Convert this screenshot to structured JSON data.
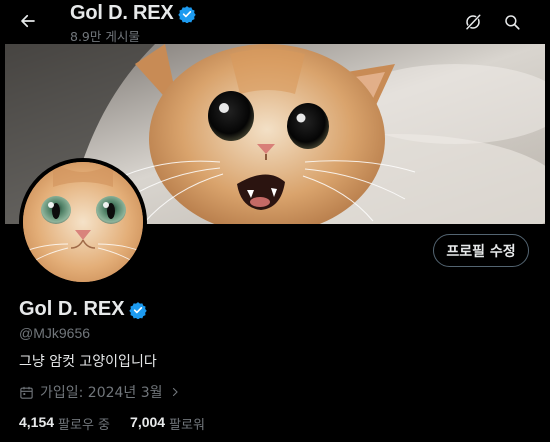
{
  "header": {
    "title": "Gol D. REX",
    "post_count": "8.9만 게시물"
  },
  "profile": {
    "name": "Gol D. REX",
    "handle": "@MJk9656",
    "bio": "그냥 암컷 고양이입니다",
    "joined": "가입일: 2024년 3월",
    "edit_button": "프로필 수정"
  },
  "stats": {
    "following_count": "4,154",
    "following_label": "팔로우 중",
    "followers_count": "7,004",
    "followers_label": "팔로워"
  },
  "colors": {
    "background": "#000000",
    "text_primary": "#e7e9ea",
    "text_secondary": "#71767b",
    "verified": "#1d9bf0",
    "button_border": "#536471"
  },
  "icons": {
    "back": "arrow-left-icon",
    "grok": "grok-icon",
    "search": "search-icon",
    "verified": "verified-badge-icon",
    "calendar": "calendar-icon",
    "chevron": "chevron-right-icon"
  }
}
